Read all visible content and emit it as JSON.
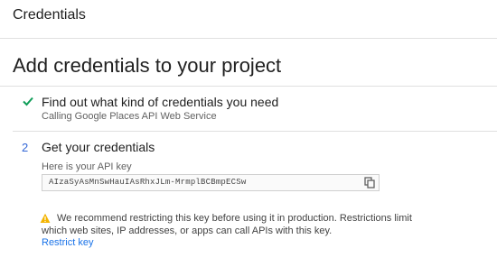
{
  "header": {
    "title": "Credentials"
  },
  "page": {
    "title": "Add credentials to your project"
  },
  "step1": {
    "title": "Find out what kind of credentials you need",
    "subtitle": "Calling Google Places API Web Service",
    "icon": "check-icon",
    "status_color": "#0f9d58"
  },
  "step2": {
    "number": "2",
    "title": "Get your credentials",
    "key_label": "Here is your API key",
    "api_key": "AIzaSyAsMnSwHauIAsRhxJLm-MrmplBCBmpECSw",
    "copy_icon": "copy-icon"
  },
  "warning": {
    "icon": "warning-icon",
    "text": "We recommend restricting this key before using it in production. Restrictions limit which web sites, IP addresses, or apps can call APIs with this key.",
    "link": "Restrict key"
  },
  "colors": {
    "accent": "#3367d6",
    "warning": "#f4b400",
    "link": "#1a73e8"
  }
}
